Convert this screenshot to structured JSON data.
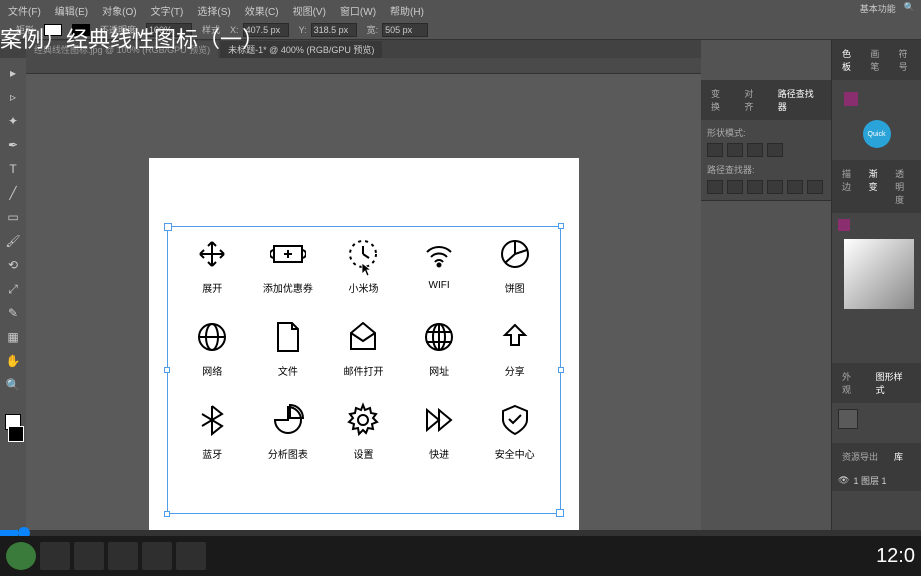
{
  "menu": {
    "items": [
      "文件(F)",
      "编辑(E)",
      "对象(O)",
      "文字(T)",
      "选择(S)",
      "效果(C)",
      "视图(V)",
      "窗口(W)",
      "帮助(H)"
    ]
  },
  "top_right": {
    "label1": "基本功能",
    "label2": ""
  },
  "title": "案例）经典线性图标（一）",
  "toolbar": {
    "rect": "矩形",
    "dim1": "",
    "opacity_label": "不透明度",
    "opacity": "100%",
    "style_label": "样式",
    "x": "407.5 px",
    "y": "318.5 px",
    "w": "505 px",
    "h": ""
  },
  "tabs": {
    "t1": "经典线性图标.jpg @ 100% (RGB/GPU 预览)",
    "t2": "未标题-1* @ 400% (RGB/GPU 预览)"
  },
  "icons": [
    {
      "name": "move-icon",
      "label": "展开"
    },
    {
      "name": "coupon-icon",
      "label": "添加优惠券"
    },
    {
      "name": "timer-icon",
      "label": "小米场"
    },
    {
      "name": "wifi-icon",
      "label": "WIFI"
    },
    {
      "name": "pie-icon",
      "label": "饼图"
    },
    {
      "name": "globe-icon",
      "label": "网络"
    },
    {
      "name": "file-icon",
      "label": "文件"
    },
    {
      "name": "mail-open-icon",
      "label": "邮件打开"
    },
    {
      "name": "web-icon",
      "label": "网址"
    },
    {
      "name": "share-icon",
      "label": "分享"
    },
    {
      "name": "bluetooth-icon",
      "label": "蓝牙"
    },
    {
      "name": "chart-icon",
      "label": "分析图表"
    },
    {
      "name": "settings-icon",
      "label": "设置"
    },
    {
      "name": "forward-icon",
      "label": "快进"
    },
    {
      "name": "shield-icon",
      "label": "安全中心"
    }
  ],
  "panel1": {
    "tab1": "变换",
    "tab2": "对齐",
    "tab3": "路径查找器",
    "mode": "形状模式:",
    "finder": "路径查找器:"
  },
  "col2": {
    "tab_color": "色板",
    "tab_brush": "画笔",
    "tab_symbol": "符号",
    "quick": "Quick",
    "grad_tab1": "描边",
    "grad_tab2": "渐变",
    "grad_tab3": "透明度",
    "layer_tab1": "外观",
    "layer_tab2": "图形样式",
    "lib": "资源导出",
    "lib2": "库",
    "layer1": "1  图层 1"
  },
  "time": "12:0"
}
